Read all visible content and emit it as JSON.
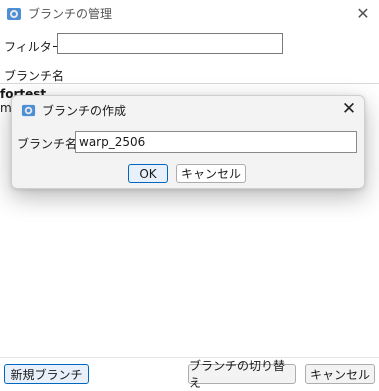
{
  "window": {
    "title": "ブランチの管理",
    "close_glyph": "✕"
  },
  "filter": {
    "label": "フィルター:",
    "value": ""
  },
  "list": {
    "column_header": "ブランチ名",
    "rows": [
      {
        "name": "fortest",
        "bold": true
      },
      {
        "name": "m",
        "bold": false
      }
    ]
  },
  "footer": {
    "new_branch_label": "新規ブランチ",
    "switch_branch_label": "ブランチの切り替え",
    "cancel_label": "キャンセル"
  },
  "dialog": {
    "title": "ブランチの作成",
    "close_glyph": "✕",
    "field_label": "ブランチ名:",
    "field_value": "warp_2506",
    "ok_label": "OK",
    "cancel_label": "キャンセル"
  },
  "colors": {
    "accent": "#0067c0",
    "dialog_bg": "#f3f3f3"
  },
  "icons": {
    "app": "tortoise-app-icon",
    "dialog": "tortoise-app-icon"
  }
}
